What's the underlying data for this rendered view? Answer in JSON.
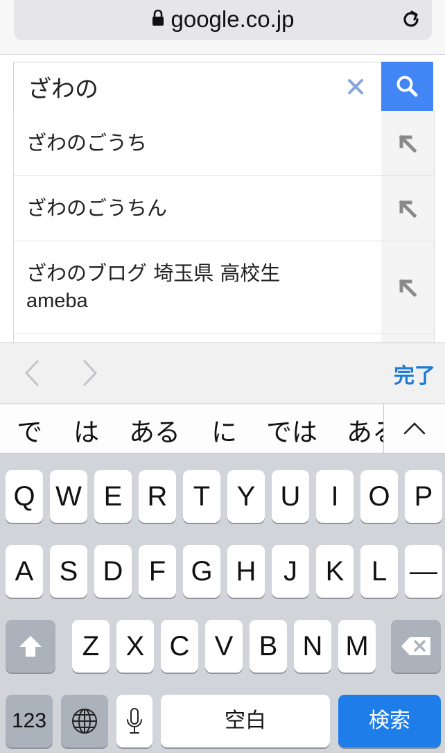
{
  "url_bar": {
    "domain": "google.co.jp"
  },
  "search": {
    "query": "ざわの"
  },
  "suggestions": [
    {
      "line1": "ざわのごうち",
      "line2": ""
    },
    {
      "line1": "ざわのごうちん",
      "line2": ""
    },
    {
      "line1": "ざわのブログ 埼玉県 高校生",
      "line2": "ameba"
    }
  ],
  "accessory": {
    "done_label": "完了"
  },
  "candidates": [
    "で",
    "は",
    "ある",
    "に",
    "では",
    "ある"
  ],
  "keyboard": {
    "row1": [
      "Q",
      "W",
      "E",
      "R",
      "T",
      "Y",
      "U",
      "I",
      "O",
      "P"
    ],
    "row2": [
      "A",
      "S",
      "D",
      "F",
      "G",
      "H",
      "J",
      "K",
      "L",
      "—"
    ],
    "row3": [
      "Z",
      "X",
      "C",
      "V",
      "B",
      "N",
      "M"
    ],
    "numbers_label": "123",
    "space_label": "空白",
    "search_label": "検索"
  },
  "colors": {
    "accent": "#4285f4",
    "done": "#1b7ad6",
    "return_key": "#1f7de9",
    "keyboard_bg": "#d1d4d9"
  },
  "icons": [
    "lock-icon",
    "reload-icon",
    "clear-icon",
    "search-icon",
    "insert-arrow-icon",
    "chevron-left-icon",
    "chevron-right-icon",
    "chevron-up-icon",
    "shift-icon",
    "backspace-icon",
    "globe-icon",
    "microphone-icon"
  ]
}
